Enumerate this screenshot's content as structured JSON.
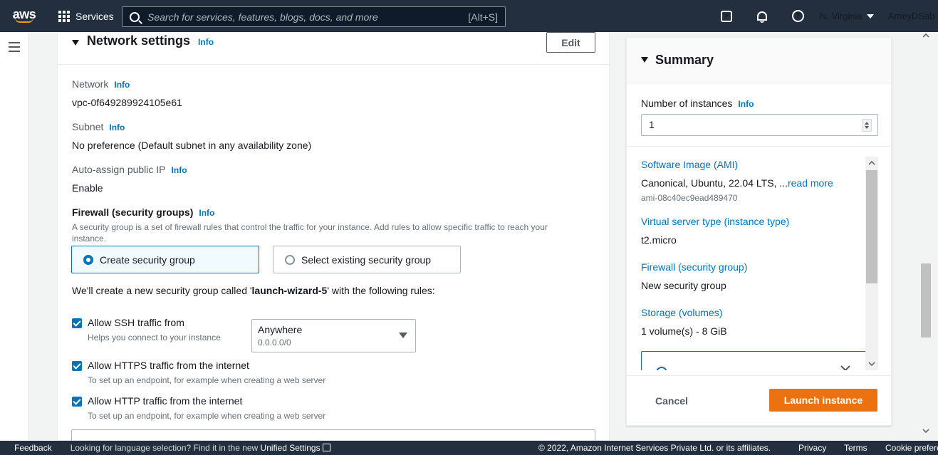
{
  "topnav": {
    "logo": "aws",
    "services_label": "Services",
    "search_placeholder": "Search for services, features, blogs, docs, and more",
    "search_shortcut": "[Alt+S]",
    "region": "N. Virginia",
    "account": "AmeyDSab"
  },
  "network": {
    "title": "Network settings",
    "info": "Info",
    "edit_label": "Edit",
    "network_label": "Network",
    "network_value": "vpc-0f649289924105e61",
    "subnet_label": "Subnet",
    "subnet_value": "No preference (Default subnet in any availability zone)",
    "public_ip_label": "Auto-assign public IP",
    "public_ip_value": "Enable",
    "firewall_label": "Firewall (security groups)",
    "firewall_desc": "A security group is a set of firewall rules that control the traffic for your instance. Add rules to allow specific traffic to reach your instance.",
    "option_create": "Create security group",
    "option_existing": "Select existing security group",
    "rules_intro_prefix": "We'll create a new security group called '",
    "rules_group_name": "launch-wizard-5",
    "rules_intro_suffix": "' with the following rules:",
    "rules": [
      {
        "label": "Allow SSH traffic from",
        "desc": "Helps you connect to your instance",
        "checked": true
      },
      {
        "label": "Allow HTTPS traffic from the internet",
        "desc": "To set up an endpoint, for example when creating a web server",
        "checked": true
      },
      {
        "label": "Allow HTTP traffic from the internet",
        "desc": "To set up an endpoint, for example when creating a web server",
        "checked": true
      }
    ],
    "ssh_source": "Anywhere",
    "ssh_cidr": "0.0.0.0/0"
  },
  "summary": {
    "title": "Summary",
    "instances_label": "Number of instances",
    "info": "Info",
    "instances_value": "1",
    "ami_label": "Software Image (AMI)",
    "ami_value": "Canonical, Ubuntu, 22.04 LTS, ...",
    "ami_read_more": "read more",
    "ami_id": "ami-08c40ec9ead489470",
    "instance_type_label": "Virtual server type (instance type)",
    "instance_type_value": "t2.micro",
    "firewall_label": "Firewall (security group)",
    "firewall_value": "New security group",
    "storage_label": "Storage (volumes)",
    "storage_value": "1 volume(s) - 8 GiB",
    "cancel_label": "Cancel",
    "launch_label": "Launch instance"
  },
  "footer": {
    "feedback": "Feedback",
    "lang_text": "Looking for language selection? Find it in the new ",
    "lang_link": "Unified Settings",
    "copyright": "© 2022, Amazon Internet Services Private Ltd. or its affiliates.",
    "privacy": "Privacy",
    "terms": "Terms",
    "cookie": "Cookie preferences"
  },
  "colors": {
    "nav_bg": "#232f3e",
    "link": "#0073bb",
    "launch": "#ec7211"
  }
}
